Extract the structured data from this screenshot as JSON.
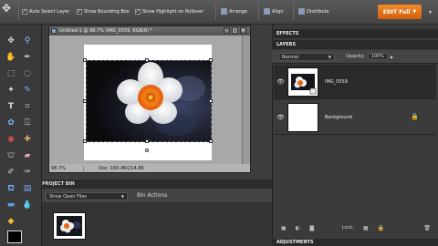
{
  "options_bar": {
    "auto_select_label": "Auto Select Layer",
    "bounding_box_label": "Show Bounding Box",
    "highlight_label": "Show Highlight on Rollover",
    "arrange_label": "Arrange",
    "align_label": "Align",
    "distribute_label": "Distribute",
    "edit_full_label": "EDIT Full"
  },
  "document": {
    "title": "Untitled-1 @ 98.7% (IMG_0559, RGB/8) *",
    "zoom": "98.7%",
    "doc_info": "Doc: 160.4K/214.8K"
  },
  "project_bin": {
    "title": "PROJECT BIN",
    "show_label": "Show Open Files",
    "bin_actions_label": "Bin Actions"
  },
  "panels": {
    "effects_label": "EFFECTS",
    "layers_label": "LAYERS",
    "blend_mode": "Normal",
    "opacity_label": "Opacity:",
    "opacity_value": "100%",
    "layers": [
      {
        "name": "IMG_0559"
      },
      {
        "name": "Background"
      }
    ],
    "lock_label": "Lock:",
    "adjustments_label": "ADJUSTMENTS"
  },
  "colors": {
    "accent": "#e8751a",
    "flower_center": "#e8650f"
  }
}
